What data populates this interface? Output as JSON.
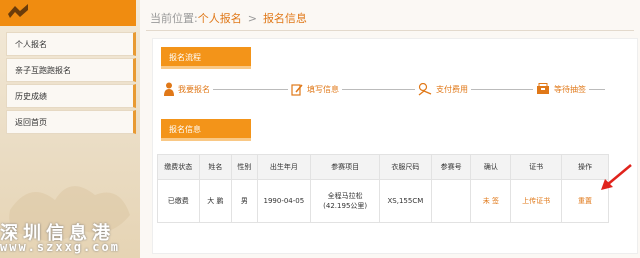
{
  "sidebar": {
    "items": [
      {
        "label": "个人报名"
      },
      {
        "label": "亲子互跑跑报名"
      },
      {
        "label": "历史成绩"
      },
      {
        "label": "返回首页"
      }
    ]
  },
  "breadcrumb": {
    "prefix": "当前位置:",
    "current": "个人报名",
    "separator": ">",
    "page": "报名信息"
  },
  "process": {
    "title": "报名流程",
    "steps": [
      {
        "label": "我要报名",
        "icon": "person-icon"
      },
      {
        "label": "填写信息",
        "icon": "edit-icon"
      },
      {
        "label": "支付费用",
        "icon": "payment-icon"
      },
      {
        "label": "等待抽签",
        "icon": "lottery-box-icon"
      }
    ]
  },
  "info": {
    "title": "报名信息",
    "columns": [
      "缴费状态",
      "姓名",
      "性别",
      "出生年月",
      "参赛项目",
      "衣服尺码",
      "参赛号",
      "确认",
      "证书",
      "操作"
    ],
    "rows": [
      {
        "status": "已缴费",
        "name": "大 鹏",
        "gender": "男",
        "birth": "1990-04-05",
        "event_line1": "全程马拉松",
        "event_line2": "(42.195公里)",
        "size": "XS,155CM",
        "bib": "",
        "confirm": "未 签",
        "certificate": "上传证书",
        "action": "重置"
      }
    ]
  },
  "watermark": {
    "text": "深圳信息港",
    "url": "www.szxxg.com"
  },
  "colors": {
    "accent": "#f39419",
    "link": "#e07818"
  }
}
